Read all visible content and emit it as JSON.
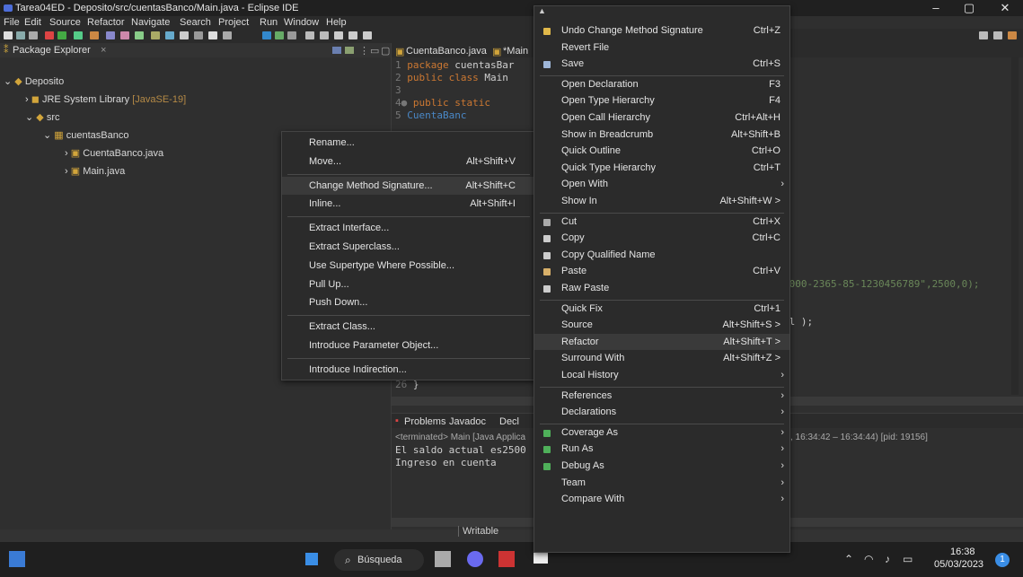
{
  "window": {
    "title": "Tarea04ED - Deposito/src/cuentasBanco/Main.java - Eclipse IDE"
  },
  "menubar": [
    "File",
    "Edit",
    "Source",
    "Refactor",
    "Navigate",
    "Search",
    "Project",
    "Run",
    "Window",
    "Help"
  ],
  "package_explorer": {
    "title": "Package Explorer",
    "close": "×",
    "project": "Deposito",
    "jre_prefix": "JRE System Library",
    "jre_suffix": "[JavaSE-19]",
    "src": "src",
    "package": "cuentasBanco",
    "files": [
      "CuentaBanco.java",
      "Main.java"
    ]
  },
  "editor": {
    "tabs": [
      "CuentaBanco.java",
      "*Main"
    ],
    "code": [
      {
        "n": "1",
        "kw": "package",
        "rest": " cuentasBar"
      },
      {
        "n": "2",
        "kw": "public class",
        "rest": " Main"
      },
      {
        "n": "3",
        "kw": "",
        "rest": ""
      },
      {
        "n": "4●",
        "kw": "public static",
        "rest": ""
      },
      {
        "n": "5",
        "kw": "",
        "rest": "CuentaBanc"
      }
    ],
    "snippet1": "1000-2365-85-1230456789\",2500,0);",
    "snippet2": "al );",
    "line26": "26",
    "brace": "}"
  },
  "console": {
    "tabs": [
      "Problems",
      "Javadoc",
      "Decl"
    ],
    "terminated": "<terminated> Main [Java Applica",
    "time": ", 16:34:42 – 16:34:44) [pid: 19156]",
    "lines": [
      "El saldo actual es2500",
      "Ingreso en cuenta"
    ]
  },
  "status": {
    "writable": "Writable"
  },
  "refactor_menu": [
    {
      "label": "Rename...",
      "sc": ""
    },
    {
      "label": "Move...",
      "sc": "Alt+Shift+V"
    },
    {
      "sep": true
    },
    {
      "label": "Change Method Signature...",
      "sc": "Alt+Shift+C",
      "hl": true
    },
    {
      "label": "Inline...",
      "sc": "Alt+Shift+I"
    },
    {
      "sep": true
    },
    {
      "label": "Extract Interface...",
      "sc": ""
    },
    {
      "label": "Extract Superclass...",
      "sc": ""
    },
    {
      "label": "Use Supertype Where Possible...",
      "sc": ""
    },
    {
      "label": "Pull Up...",
      "sc": ""
    },
    {
      "label": "Push Down...",
      "sc": ""
    },
    {
      "sep": true
    },
    {
      "label": "Extract Class...",
      "sc": ""
    },
    {
      "label": "Introduce Parameter Object...",
      "sc": ""
    },
    {
      "sep": true
    },
    {
      "label": "Introduce Indirection...",
      "sc": ""
    }
  ],
  "context_menu": [
    {
      "label": "Undo Change Method Signature",
      "sc": "Ctrl+Z",
      "icon": "undo-icon"
    },
    {
      "label": "Revert File",
      "sc": ""
    },
    {
      "label": "Save",
      "sc": "Ctrl+S",
      "icon": "save-icon"
    },
    {
      "sep": true
    },
    {
      "label": "Open Declaration",
      "sc": "F3"
    },
    {
      "label": "Open Type Hierarchy",
      "sc": "F4"
    },
    {
      "label": "Open Call Hierarchy",
      "sc": "Ctrl+Alt+H"
    },
    {
      "label": "Show in Breadcrumb",
      "sc": "Alt+Shift+B"
    },
    {
      "label": "Quick Outline",
      "sc": "Ctrl+O"
    },
    {
      "label": "Quick Type Hierarchy",
      "sc": "Ctrl+T"
    },
    {
      "label": "Open With",
      "sc": "",
      "sub": true
    },
    {
      "label": "Show In",
      "sc": "Alt+Shift+W >"
    },
    {
      "sep": true
    },
    {
      "label": "Cut",
      "sc": "Ctrl+X",
      "icon": "cut-icon"
    },
    {
      "label": "Copy",
      "sc": "Ctrl+C",
      "icon": "copy-icon"
    },
    {
      "label": "Copy Qualified Name",
      "sc": "",
      "icon": "copy-qualified-icon"
    },
    {
      "label": "Paste",
      "sc": "Ctrl+V",
      "icon": "paste-icon"
    },
    {
      "label": "Raw Paste",
      "sc": "",
      "icon": "raw-paste-icon"
    },
    {
      "sep": true
    },
    {
      "label": "Quick Fix",
      "sc": "Ctrl+1"
    },
    {
      "label": "Source",
      "sc": "Alt+Shift+S >"
    },
    {
      "label": "Refactor",
      "sc": "Alt+Shift+T >",
      "hl": true
    },
    {
      "label": "Surround With",
      "sc": "Alt+Shift+Z >"
    },
    {
      "label": "Local History",
      "sc": "",
      "sub": true
    },
    {
      "sep": true
    },
    {
      "label": "References",
      "sc": "",
      "sub": true
    },
    {
      "label": "Declarations",
      "sc": "",
      "sub": true
    },
    {
      "sep": true
    },
    {
      "label": "Coverage As",
      "sc": "",
      "sub": true,
      "icon": "coverage-icon"
    },
    {
      "label": "Run As",
      "sc": "",
      "sub": true,
      "icon": "run-icon"
    },
    {
      "label": "Debug As",
      "sc": "",
      "sub": true,
      "icon": "debug-icon"
    },
    {
      "label": "Team",
      "sc": "",
      "sub": true
    },
    {
      "label": "Compare With",
      "sc": "",
      "sub": true
    }
  ],
  "taskbar": {
    "search": "Búsqueda",
    "time": "16:38",
    "date": "05/03/2023",
    "badge": "1"
  }
}
